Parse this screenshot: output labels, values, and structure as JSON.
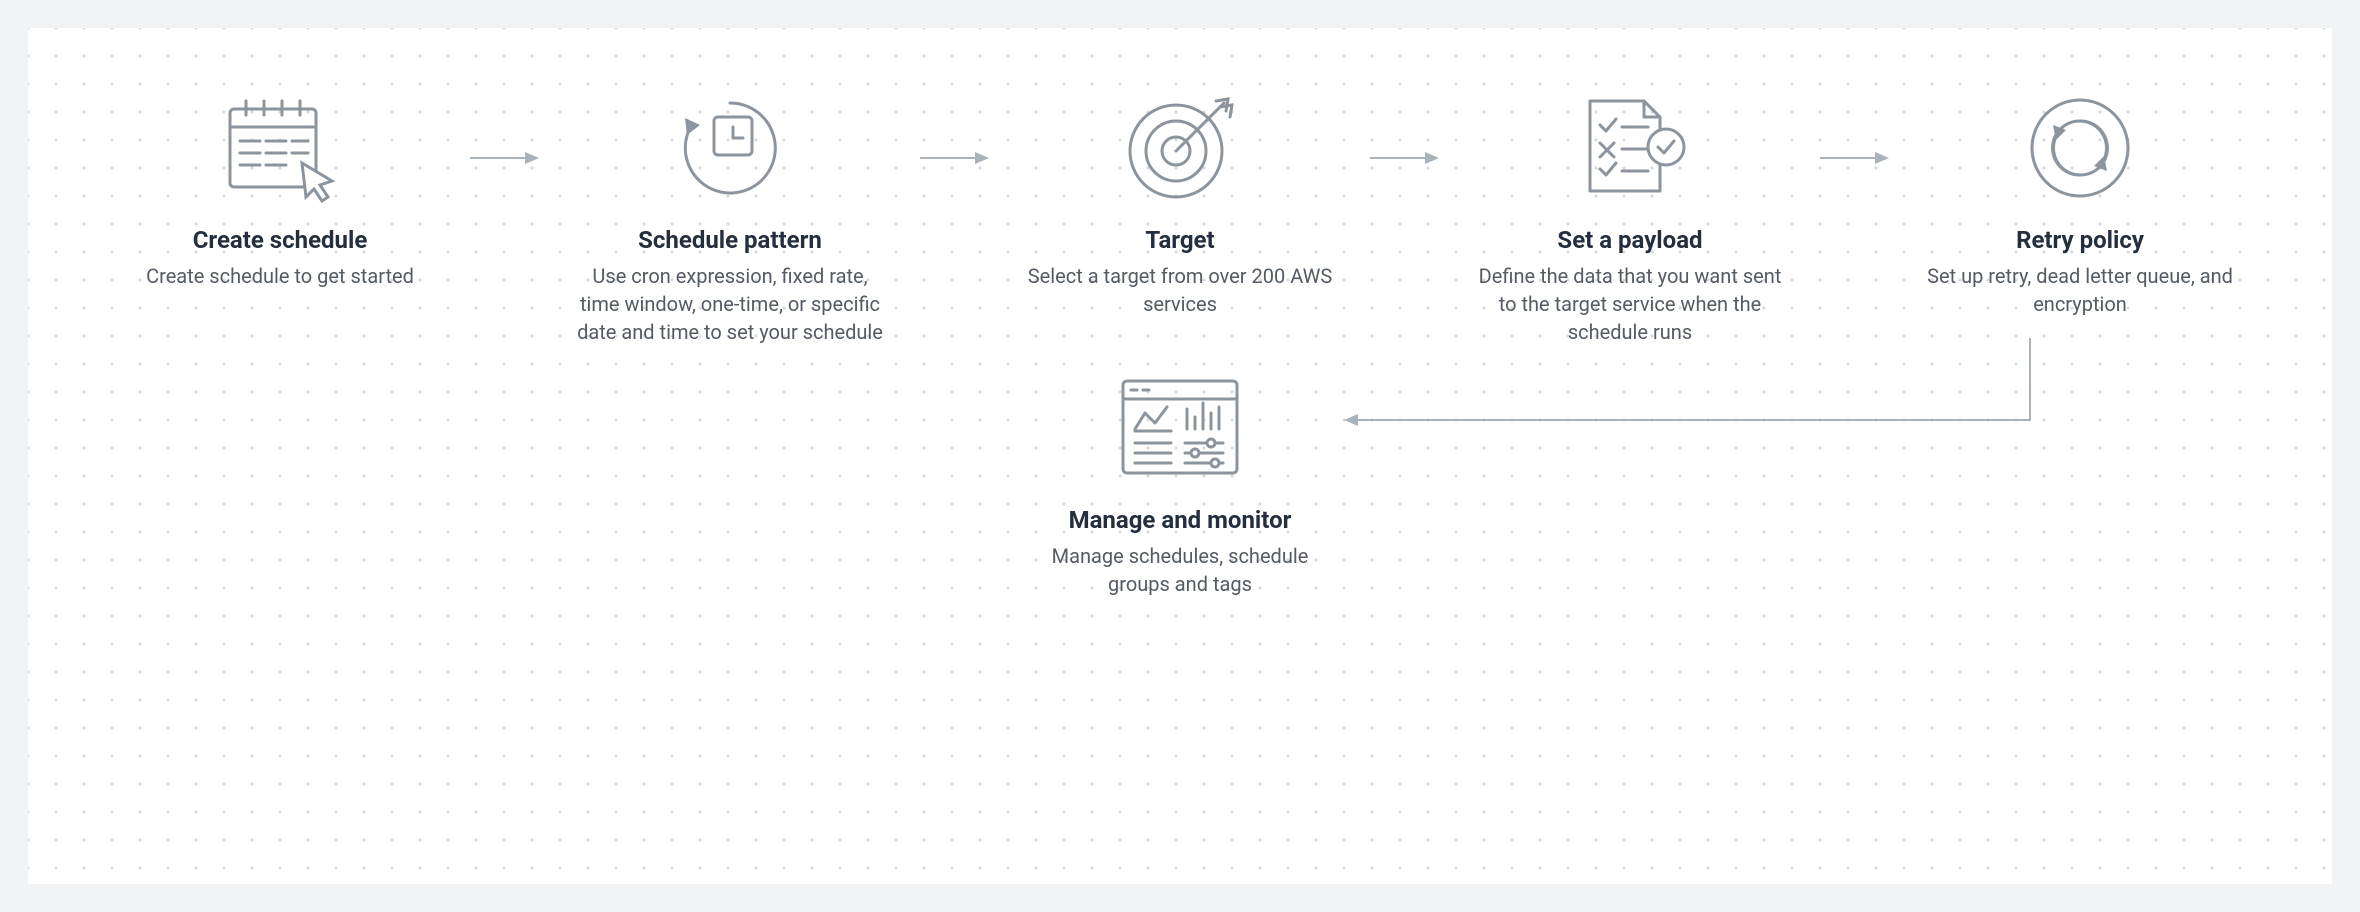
{
  "steps": [
    {
      "title": "Create schedule",
      "desc": "Create schedule to get started"
    },
    {
      "title": "Schedule pattern",
      "desc": "Use cron expression, fixed rate, time window, one-time, or specific date and time to set your schedule"
    },
    {
      "title": "Target",
      "desc": "Select a target from over 200 AWS services"
    },
    {
      "title": "Set a payload",
      "desc": "Define the data that you want sent to the target service when the schedule runs"
    },
    {
      "title": "Retry policy",
      "desc": "Set up retry, dead letter queue, and encryption"
    }
  ],
  "final": {
    "title": "Manage and monitor",
    "desc": "Manage schedules, schedule groups and tags"
  }
}
